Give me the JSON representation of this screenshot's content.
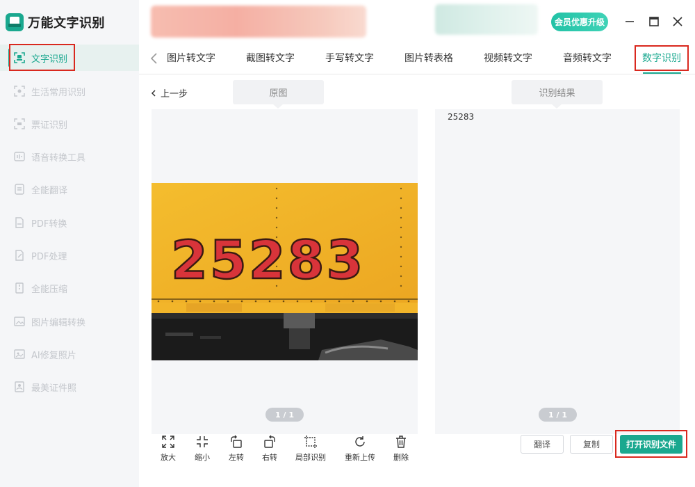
{
  "app": {
    "title": "万能文字识别"
  },
  "sidebar": {
    "items": [
      {
        "label": "文字识别",
        "icon": "text-scan-icon"
      },
      {
        "label": "生活常用识别",
        "icon": "scan-icon"
      },
      {
        "label": "票证识别",
        "icon": "ticket-icon"
      },
      {
        "label": "语音转换工具",
        "icon": "audio-icon"
      },
      {
        "label": "全能翻译",
        "icon": "translate-icon"
      },
      {
        "label": "PDF转换",
        "icon": "pdf-icon"
      },
      {
        "label": "PDF处理",
        "icon": "pdf-edit-icon"
      },
      {
        "label": "全能压缩",
        "icon": "compress-icon"
      },
      {
        "label": "图片编辑转换",
        "icon": "image-edit-icon"
      },
      {
        "label": "AI修复照片",
        "icon": "ai-photo-icon"
      },
      {
        "label": "最美证件照",
        "icon": "id-photo-icon"
      }
    ]
  },
  "header": {
    "vip_label": "会员优惠升级"
  },
  "tabs": [
    {
      "label": "图片转文字"
    },
    {
      "label": "截图转文字"
    },
    {
      "label": "手写转文字"
    },
    {
      "label": "图片转表格"
    },
    {
      "label": "视频转文字"
    },
    {
      "label": "音频转文字"
    },
    {
      "label": "数字识别"
    }
  ],
  "content": {
    "back_label": "上一步",
    "original_label": "原图",
    "result_label": "识别结果",
    "result_text": "25283",
    "photo_number": "25283",
    "left_page": "1 / 1",
    "right_page": "1 / 1"
  },
  "toolbar": [
    {
      "label": "放大",
      "icon": "expand-icon"
    },
    {
      "label": "缩小",
      "icon": "shrink-icon"
    },
    {
      "label": "左转",
      "icon": "rotate-left-icon"
    },
    {
      "label": "右转",
      "icon": "rotate-right-icon"
    },
    {
      "label": "局部识别",
      "icon": "crop-icon"
    },
    {
      "label": "重新上传",
      "icon": "reupload-icon"
    },
    {
      "label": "删除",
      "icon": "trash-icon"
    }
  ],
  "actions": {
    "translate_label": "翻译",
    "copy_label": "复制",
    "open_file_label": "打开识别文件"
  },
  "colors": {
    "accent": "#1aa88f",
    "highlight_box": "#d9281e",
    "photo_yellow": "#f2b52a",
    "digit_red": "#d8343a"
  }
}
